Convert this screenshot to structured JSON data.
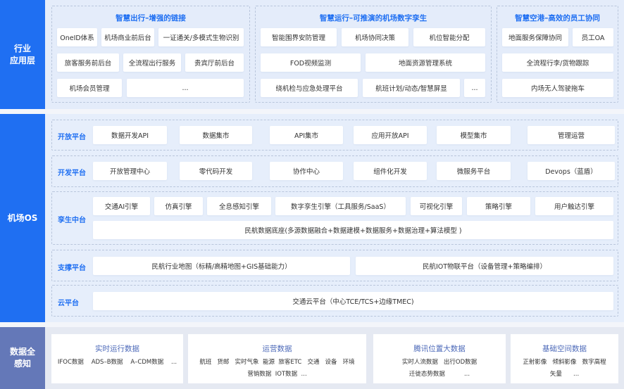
{
  "layers": {
    "application": "行业\n应用层",
    "os": "机场OS",
    "data": "数据全\n感知"
  },
  "colors": {
    "primary": "#1f6ff2",
    "data_layer": "#6478b8",
    "panel_bg": "#e4ecfa"
  },
  "app_groups": [
    {
      "title": "智慧出行–增强的链接",
      "items": [
        "OneID体系",
        "机场商业前后台",
        "一证通关/多模式生物识别",
        "旅客服务前后台",
        "全流程出行服务",
        "贵宾厅前后台",
        "机场会员管理",
        "..."
      ]
    },
    {
      "title": "智慧运行–可推演的机场数字孪生",
      "items": [
        "智能围界安防管理",
        "机场协同决策",
        "机位智能分配",
        "FOD视频监测",
        "地面资源管理系统",
        "绕机检与应急处理平台",
        "航班计划/动态/智慧屏显",
        "..."
      ]
    },
    {
      "title": "智慧空港–高效的员工协同",
      "items": [
        "地面服务保障协同",
        "员工OA",
        "全流程行李/货物跟踪",
        "内场无人驾驶拖车"
      ]
    }
  ],
  "os_rows": [
    {
      "label": "开放平台",
      "items": [
        "数据开发API",
        "数据集市",
        "API集市",
        "应用开放API",
        "模型集市",
        "管理运营"
      ]
    },
    {
      "label": "开发平台",
      "items": [
        "开放管理中心",
        "零代码开发",
        "协作中心",
        "组件化开发",
        "微服务平台",
        "Devops（蓝盾）"
      ]
    },
    {
      "label": "孪生中台",
      "items": [
        "交通AI引擎",
        "仿真引擎",
        "全息感知引擎",
        "数字孪生引擎（工具服务/SaaS）",
        "可视化引擎",
        "策略引擎",
        "用户触达引擎",
        "民航数据底座(多源数据融合+数据建模+数据服务+数据治理+算法模型 )"
      ]
    },
    {
      "label": "支撑平台",
      "items": [
        "民航行业地图（标精/高精地图+GIS基础能力）",
        "民航IOT物联平台（设备管理+策略编排）"
      ]
    },
    {
      "label": "云平台",
      "items": [
        "交通云平台（中心TCE/TCS+边缘TMEC)"
      ]
    }
  ],
  "data_cards": [
    {
      "title": "实时运行数据",
      "lines": [
        "IFOC数据    ADS–B数据    A–CDM数据    ..."
      ]
    },
    {
      "title": "运营数据",
      "lines": [
        "航班   货邮   实时气象  能源  旅客ETC   交通   设备   环境",
        "营销数据  IOT数据  ..."
      ]
    },
    {
      "title": "腾讯位置大数据",
      "lines": [
        "实时人流数据   出行OD数据",
        "迁徙态势数据          ..."
      ]
    },
    {
      "title": "基础空间数据",
      "lines": [
        "正射影像   倾斜影像   数字高程",
        "矢量      ..."
      ]
    }
  ]
}
